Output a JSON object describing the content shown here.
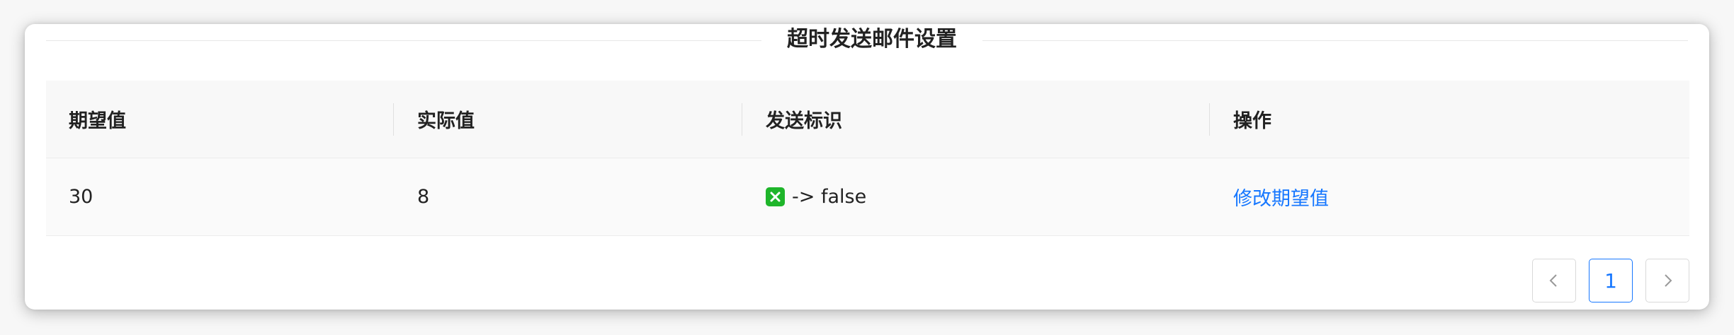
{
  "section": {
    "title": "超时发送邮件设置"
  },
  "table": {
    "headers": [
      "期望值",
      "实际值",
      "发送标识",
      "操作"
    ],
    "rows": [
      {
        "expected": "30",
        "actual": "8",
        "send_flag": "-> false",
        "send_flag_icon": "cross-mark-icon",
        "action": "修改期望值"
      }
    ]
  },
  "pagination": {
    "current_page": "1"
  },
  "colors": {
    "link": "#1677ff",
    "flag_icon_bg": "#1eb52a"
  }
}
